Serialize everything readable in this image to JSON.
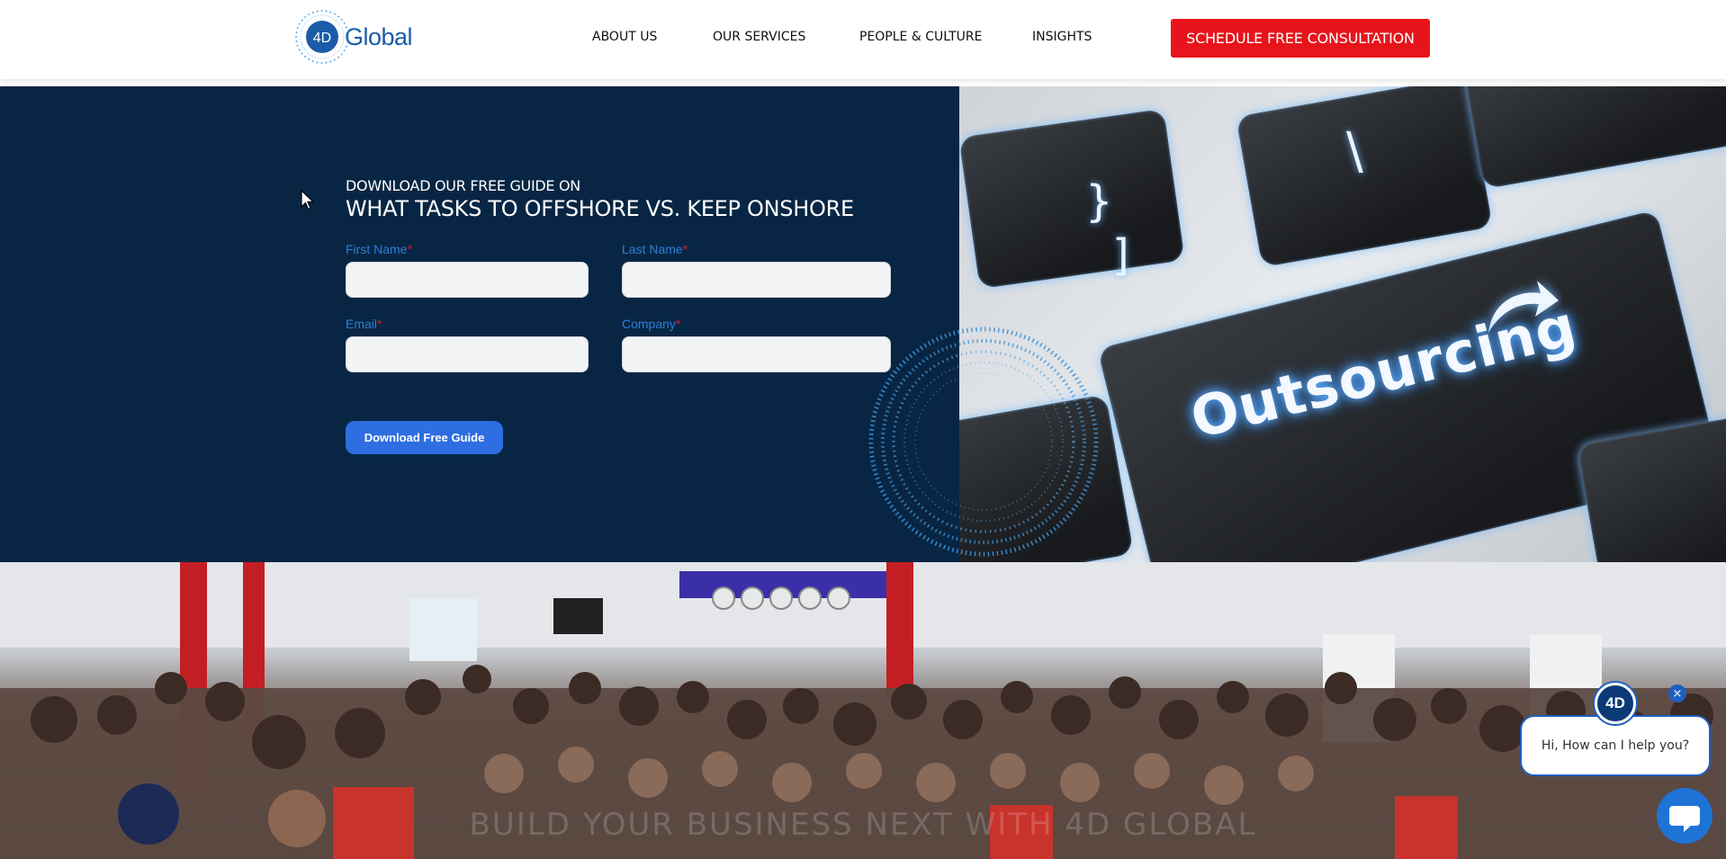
{
  "header": {
    "logo_text": "Global",
    "logo_mark": "4D",
    "nav": [
      {
        "label": "ABOUT US"
      },
      {
        "label": "OUR SERVICES"
      },
      {
        "label": "PEOPLE & CULTURE"
      },
      {
        "label": "INSIGHTS"
      }
    ],
    "cta_label": "SCHEDULE FREE CONSULTATION"
  },
  "form": {
    "overline": "DOWNLOAD OUR FREE GUIDE ON",
    "headline": "WHAT TASKS TO OFFSHORE VS. KEEP ONSHORE",
    "fields": [
      {
        "label": "First Name",
        "required": "*",
        "value": ""
      },
      {
        "label": "Last Name",
        "required": "*",
        "value": ""
      },
      {
        "label": "Email",
        "required": "*",
        "value": ""
      },
      {
        "label": "Company",
        "required": "*",
        "value": ""
      }
    ],
    "submit_label": "Download Free Guide"
  },
  "hero_image": {
    "key_text": "Outsourcing",
    "key_glyph_1": "}",
    "key_glyph_2": "]",
    "key_glyph_3": "\\"
  },
  "team_photo": {
    "caption": "BUILD YOUR BUSINESS NEXT WITH 4D GLOBAL"
  },
  "chat": {
    "avatar_text": "4D",
    "greeting": "Hi, How can I help you?",
    "close_glyph": "×"
  },
  "colors": {
    "navy": "#082644",
    "cta_red": "#e8141b",
    "button_blue": "#2e6ee0",
    "label_blue": "#2e7ed8"
  }
}
